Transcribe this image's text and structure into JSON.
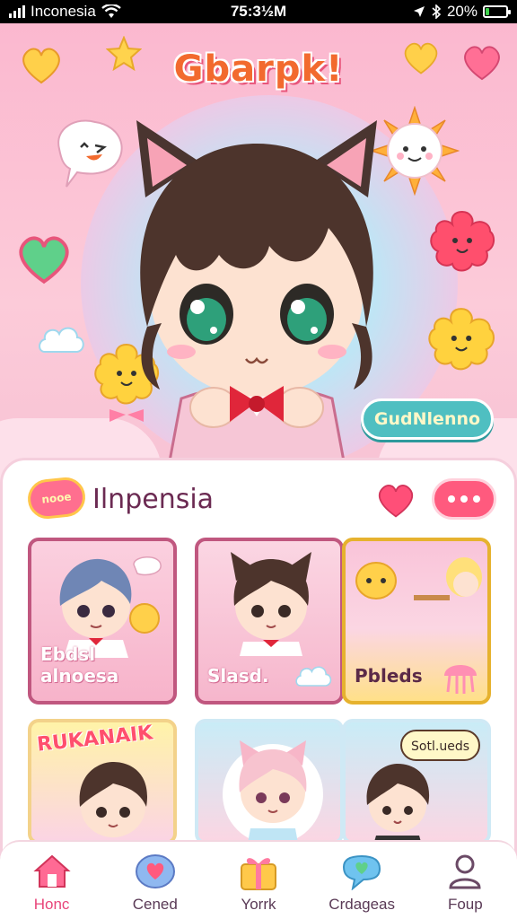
{
  "status_bar": {
    "carrier": "Inconesia",
    "time": "75:3½M",
    "battery_percent": "20%",
    "battery_level": 0.2
  },
  "hero": {
    "title": "Gbarpk!",
    "tag_button": "GudNlenno"
  },
  "panel": {
    "badge": "nooe",
    "title": "Ilnpensia"
  },
  "cards": [
    {
      "label": "Ebdsl alnoesa"
    },
    {
      "label": "Slasd."
    },
    {
      "label": "Pbleds"
    },
    {
      "label": "RUKANAIK"
    },
    {
      "label": ""
    },
    {
      "label": "Sotl.ueds"
    }
  ],
  "tabs": [
    {
      "label": "Honc",
      "icon": "home-icon",
      "active": true
    },
    {
      "label": "Cened",
      "icon": "heart-bubble-icon",
      "active": false
    },
    {
      "label": "Yorrk",
      "icon": "gift-icon",
      "active": false
    },
    {
      "label": "Crdageas",
      "icon": "chat-heart-icon",
      "active": false
    },
    {
      "label": "Foup",
      "icon": "user-icon",
      "active": false
    }
  ],
  "colors": {
    "accent": "#ff5a7e",
    "hero_title": "#f26a2e",
    "tag_button": "#4fbfc1",
    "tab_active": "#e8457a"
  }
}
